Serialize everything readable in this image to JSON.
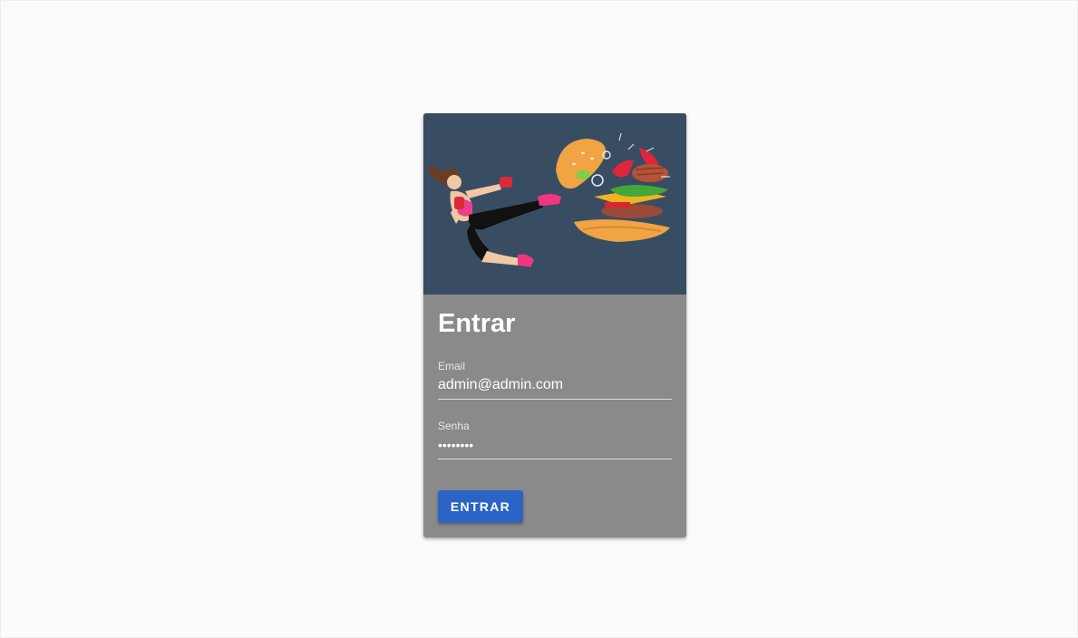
{
  "login": {
    "title": "Entrar",
    "email_label": "Email",
    "email_value": "admin@admin.com",
    "password_label": "Senha",
    "password_value": "••••••••",
    "submit_label": "ENTRAR"
  },
  "colors": {
    "hero_background": "#394d62",
    "card_background": "#8a8a8a",
    "button": "#2c64c6"
  },
  "hero_image": {
    "icon": "kick-burger-illustration"
  }
}
